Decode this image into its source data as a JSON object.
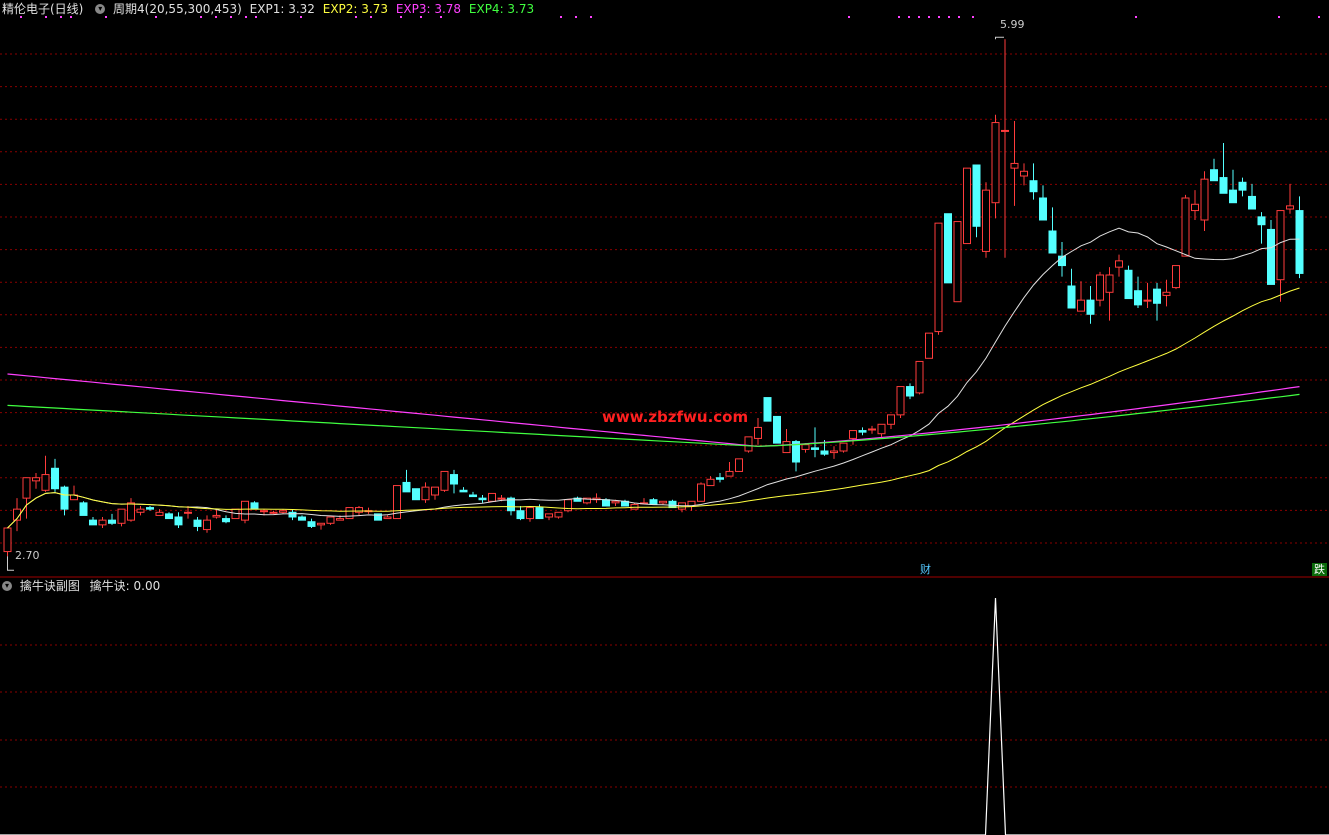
{
  "header": {
    "stock_name": "精伦电子(日线)",
    "indicator_name": "周期4(20,55,300,453)",
    "lines": [
      {
        "label": "EXP1: 3.32",
        "color": "#e0e0e0"
      },
      {
        "label": "EXP2: 3.73",
        "color": "#ffff40"
      },
      {
        "label": "EXP3: 3.78",
        "color": "#ff40ff"
      },
      {
        "label": "EXP4: 3.73",
        "color": "#40ff40"
      }
    ]
  },
  "price_labels": {
    "high": "5.99",
    "low": "2.70"
  },
  "badges": {
    "cai": "财",
    "die": "跌"
  },
  "watermark": "www.zbzfwu.com",
  "sub_panel": {
    "title": "擒牛诀副图",
    "value_label": "擒牛诀: 0.00"
  },
  "colors": {
    "up": "#ff3c3c",
    "down": "#54ffff",
    "grid": "#8a0000",
    "exp1": "#e0e0e0",
    "exp2": "#ffff40",
    "exp3": "#ff40ff",
    "exp4": "#40ff40",
    "signal": "#ffffff"
  },
  "chart_data": {
    "type": "candlestick",
    "ylim": [
      2.6,
      6.1
    ],
    "candles": [
      [
        2.73,
        2.88,
        2.7,
        2.88
      ],
      [
        2.93,
        3.07,
        2.86,
        3.0
      ],
      [
        3.07,
        3.2,
        2.94,
        3.2
      ],
      [
        3.18,
        3.23,
        3.13,
        3.2
      ],
      [
        3.12,
        3.34,
        3.11,
        3.22
      ],
      [
        3.26,
        3.32,
        3.11,
        3.13
      ],
      [
        3.14,
        3.15,
        2.96,
        3.0
      ],
      [
        3.06,
        3.15,
        3.06,
        3.09
      ],
      [
        3.04,
        3.05,
        2.96,
        2.96
      ],
      [
        2.93,
        2.95,
        2.9,
        2.9
      ],
      [
        2.9,
        2.95,
        2.88,
        2.93
      ],
      [
        2.93,
        2.97,
        2.9,
        2.91
      ],
      [
        2.91,
        3.0,
        2.89,
        3.0
      ],
      [
        2.93,
        3.07,
        2.92,
        3.04
      ],
      [
        2.98,
        3.02,
        2.96,
        3.0
      ],
      [
        3.01,
        3.02,
        2.99,
        3.0
      ],
      [
        2.96,
        3.0,
        2.96,
        2.98
      ],
      [
        2.97,
        2.98,
        2.94,
        2.94
      ],
      [
        2.95,
        2.98,
        2.88,
        2.9
      ],
      [
        2.98,
        3.02,
        2.94,
        2.98
      ],
      [
        2.93,
        2.95,
        2.86,
        2.89
      ],
      [
        2.87,
        2.96,
        2.85,
        2.93
      ],
      [
        2.95,
        3.0,
        2.94,
        2.96
      ],
      [
        2.94,
        2.96,
        2.91,
        2.92
      ],
      [
        2.94,
        3.0,
        2.94,
        3.0
      ],
      [
        2.93,
        3.05,
        2.91,
        3.05
      ],
      [
        3.04,
        3.05,
        3.0,
        3.0
      ],
      [
        2.99,
        3.0,
        2.96,
        2.99
      ],
      [
        2.98,
        2.99,
        2.97,
        2.98
      ],
      [
        2.98,
        3.0,
        2.97,
        2.99
      ],
      [
        2.98,
        3.0,
        2.93,
        2.95
      ],
      [
        2.95,
        2.96,
        2.93,
        2.93
      ],
      [
        2.92,
        2.94,
        2.88,
        2.89
      ],
      [
        2.9,
        2.91,
        2.87,
        2.91
      ],
      [
        2.91,
        2.95,
        2.9,
        2.95
      ],
      [
        2.93,
        2.96,
        2.93,
        2.94
      ],
      [
        2.94,
        3.01,
        2.94,
        3.01
      ],
      [
        2.98,
        3.02,
        2.96,
        3.01
      ],
      [
        2.99,
        3.01,
        2.97,
        2.99
      ],
      [
        2.97,
        2.97,
        2.93,
        2.93
      ],
      [
        2.94,
        2.96,
        2.94,
        2.95
      ],
      [
        2.94,
        3.15,
        2.94,
        3.15
      ],
      [
        3.17,
        3.25,
        3.11,
        3.11
      ],
      [
        3.13,
        3.13,
        3.06,
        3.06
      ],
      [
        3.06,
        3.17,
        3.04,
        3.14
      ],
      [
        3.09,
        3.14,
        3.06,
        3.14
      ],
      [
        3.12,
        3.24,
        3.11,
        3.24
      ],
      [
        3.22,
        3.25,
        3.1,
        3.16
      ],
      [
        3.12,
        3.14,
        3.11,
        3.11
      ],
      [
        3.09,
        3.11,
        3.08,
        3.08
      ],
      [
        3.07,
        3.09,
        3.04,
        3.06
      ],
      [
        3.05,
        3.1,
        3.05,
        3.1
      ],
      [
        3.07,
        3.09,
        3.05,
        3.07
      ],
      [
        3.07,
        3.08,
        2.96,
        2.99
      ],
      [
        2.99,
        3.02,
        2.93,
        2.94
      ],
      [
        2.94,
        3.02,
        2.92,
        3.01
      ],
      [
        3.01,
        3.03,
        2.94,
        2.94
      ],
      [
        2.95,
        2.97,
        2.93,
        2.97
      ],
      [
        2.95,
        2.98,
        2.94,
        2.98
      ],
      [
        2.99,
        3.06,
        2.98,
        3.06
      ],
      [
        3.07,
        3.08,
        3.05,
        3.05
      ],
      [
        3.04,
        3.07,
        3.03,
        3.07
      ],
      [
        3.06,
        3.1,
        3.04,
        3.07
      ],
      [
        3.06,
        3.07,
        3.02,
        3.02
      ],
      [
        3.04,
        3.06,
        3.02,
        3.05
      ],
      [
        3.05,
        3.06,
        3.02,
        3.02
      ],
      [
        3.0,
        3.04,
        3.0,
        3.03
      ],
      [
        3.04,
        3.07,
        3.03,
        3.04
      ],
      [
        3.06,
        3.07,
        3.03,
        3.03
      ],
      [
        3.04,
        3.05,
        3.03,
        3.05
      ],
      [
        3.05,
        3.06,
        3.01,
        3.01
      ],
      [
        3.0,
        3.04,
        2.98,
        3.04
      ],
      [
        3.02,
        3.05,
        2.99,
        3.05
      ],
      [
        3.05,
        3.17,
        3.05,
        3.16
      ],
      [
        3.15,
        3.21,
        3.15,
        3.19
      ],
      [
        3.2,
        3.23,
        3.17,
        3.19
      ],
      [
        3.21,
        3.3,
        3.21,
        3.24
      ],
      [
        3.24,
        3.32,
        3.24,
        3.32
      ],
      [
        3.37,
        3.46,
        3.36,
        3.46
      ],
      [
        3.45,
        3.58,
        3.41,
        3.52
      ],
      [
        3.71,
        3.71,
        3.56,
        3.56
      ],
      [
        3.59,
        3.59,
        3.42,
        3.42
      ],
      [
        3.36,
        3.51,
        3.36,
        3.43
      ],
      [
        3.43,
        3.44,
        3.24,
        3.3
      ],
      [
        3.38,
        3.42,
        3.36,
        3.41
      ],
      [
        3.39,
        3.52,
        3.33,
        3.38
      ],
      [
        3.37,
        3.44,
        3.34,
        3.35
      ],
      [
        3.36,
        3.4,
        3.32,
        3.37
      ],
      [
        3.37,
        3.42,
        3.36,
        3.42
      ],
      [
        3.45,
        3.5,
        3.41,
        3.5
      ],
      [
        3.5,
        3.52,
        3.47,
        3.49
      ],
      [
        3.51,
        3.53,
        3.48,
        3.51
      ],
      [
        3.48,
        3.54,
        3.46,
        3.54
      ],
      [
        3.54,
        3.6,
        3.51,
        3.6
      ],
      [
        3.6,
        3.78,
        3.58,
        3.78
      ],
      [
        3.78,
        3.8,
        3.7,
        3.72
      ],
      [
        3.74,
        3.94,
        3.73,
        3.94
      ],
      [
        3.96,
        4.12,
        3.96,
        4.12
      ],
      [
        4.13,
        4.82,
        4.11,
        4.82
      ],
      [
        4.88,
        4.88,
        4.44,
        4.44
      ],
      [
        4.32,
        4.83,
        4.32,
        4.83
      ],
      [
        4.69,
        5.17,
        4.69,
        5.17
      ],
      [
        5.19,
        5.19,
        4.73,
        4.8
      ],
      [
        4.64,
        5.08,
        4.6,
        5.03
      ],
      [
        4.95,
        5.51,
        4.85,
        5.46
      ],
      [
        5.41,
        5.99,
        4.6,
        5.41
      ],
      [
        5.17,
        5.47,
        4.93,
        5.2
      ],
      [
        5.12,
        5.2,
        5.06,
        5.15
      ],
      [
        5.09,
        5.2,
        4.97,
        5.02
      ],
      [
        4.98,
        5.06,
        4.86,
        4.84
      ],
      [
        4.77,
        4.92,
        4.66,
        4.63
      ],
      [
        4.61,
        4.7,
        4.48,
        4.55
      ],
      [
        4.42,
        4.53,
        4.28,
        4.28
      ],
      [
        4.26,
        4.45,
        4.26,
        4.33
      ],
      [
        4.33,
        4.42,
        4.18,
        4.24
      ],
      [
        4.33,
        4.51,
        4.29,
        4.49
      ],
      [
        4.38,
        4.54,
        4.2,
        4.49
      ],
      [
        4.54,
        4.62,
        4.48,
        4.58
      ],
      [
        4.52,
        4.55,
        4.34,
        4.34
      ],
      [
        4.39,
        4.48,
        4.28,
        4.3
      ],
      [
        4.33,
        4.44,
        4.28,
        4.33
      ],
      [
        4.4,
        4.44,
        4.2,
        4.31
      ],
      [
        4.36,
        4.46,
        4.29,
        4.38
      ],
      [
        4.41,
        4.55,
        4.4,
        4.55
      ],
      [
        4.61,
        5.0,
        4.61,
        4.98
      ],
      [
        4.9,
        5.03,
        4.84,
        4.94
      ],
      [
        4.84,
        5.15,
        4.77,
        5.1
      ],
      [
        5.16,
        5.23,
        5.16,
        5.09
      ],
      [
        5.11,
        5.33,
        5.02,
        5.01
      ],
      [
        5.03,
        5.16,
        4.96,
        4.95
      ],
      [
        5.08,
        5.11,
        4.99,
        5.03
      ],
      [
        4.99,
        5.07,
        4.91,
        4.91
      ],
      [
        4.86,
        4.89,
        4.69,
        4.81
      ],
      [
        4.78,
        4.84,
        4.59,
        4.43
      ],
      [
        4.46,
        4.9,
        4.32,
        4.9
      ],
      [
        4.91,
        5.07,
        4.88,
        4.93
      ],
      [
        4.9,
        4.99,
        4.47,
        4.5
      ]
    ],
    "signal": {
      "type": "line",
      "peak_bar": 104,
      "max_label": "擒牛诀: 0.00"
    }
  }
}
